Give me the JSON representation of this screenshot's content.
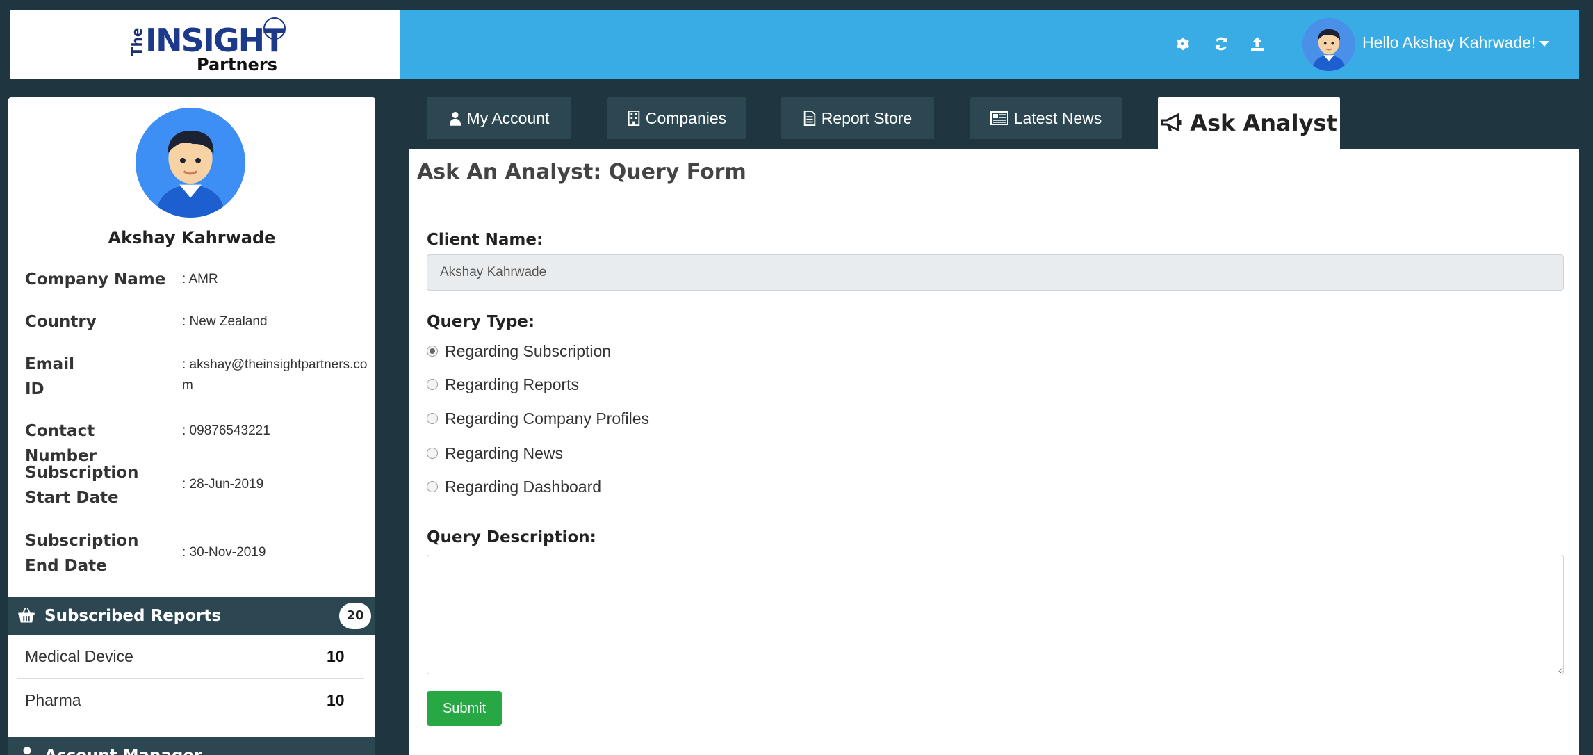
{
  "logo": {
    "the": "The",
    "brand": "INSIGHT",
    "sub": "Partners"
  },
  "header": {
    "greeting": "Hello Akshay Kahrwade!",
    "icons": [
      "gear-icon",
      "refresh-icon",
      "upload-icon"
    ]
  },
  "profile": {
    "name": "Akshay Kahrwade",
    "fields": [
      {
        "label": "Company Name",
        "value": ":  AMR"
      },
      {
        "label": "Country",
        "value": ": New Zealand"
      },
      {
        "label": "Email ID",
        "value": ":  akshay@theinsightpartners.com"
      },
      {
        "label": "Contact Number",
        "value": ": 09876543221"
      },
      {
        "label": "Subscription Start Date",
        "value": ": 28-Jun-2019"
      },
      {
        "label": "Subscription End Date",
        "value": ": 30-Nov-2019"
      }
    ]
  },
  "subscribed": {
    "title": "Subscribed Reports",
    "count": "20",
    "items": [
      {
        "label": "Medical Device",
        "count": "10"
      },
      {
        "label": "Pharma",
        "count": "10"
      }
    ]
  },
  "account_manager": {
    "title": "Account Manager"
  },
  "tabs": [
    {
      "label": "My Account",
      "icon": "user-icon"
    },
    {
      "label": "Companies",
      "icon": "building-icon"
    },
    {
      "label": "Report Store",
      "icon": "document-icon"
    },
    {
      "label": "Latest News",
      "icon": "newspaper-icon"
    },
    {
      "label": "Ask Analyst",
      "icon": "bullhorn-icon",
      "active": true
    }
  ],
  "form": {
    "title": "Ask An Analyst: Query Form",
    "client_label": "Client Name:",
    "client_value": "Akshay Kahrwade",
    "query_type_label": "Query Type:",
    "query_types": [
      {
        "label": "Regarding Subscription",
        "checked": true
      },
      {
        "label": "Regarding Reports",
        "checked": false
      },
      {
        "label": "Regarding Company Profiles",
        "checked": false
      },
      {
        "label": "Regarding News",
        "checked": false
      },
      {
        "label": "Regarding Dashboard",
        "checked": false
      }
    ],
    "description_label": "Query Description:",
    "submit_label": "Submit"
  },
  "colors": {
    "topbar": "#3aace5",
    "dark": "#1f3640",
    "panel_head": "#2c4752",
    "submit": "#28a745"
  }
}
